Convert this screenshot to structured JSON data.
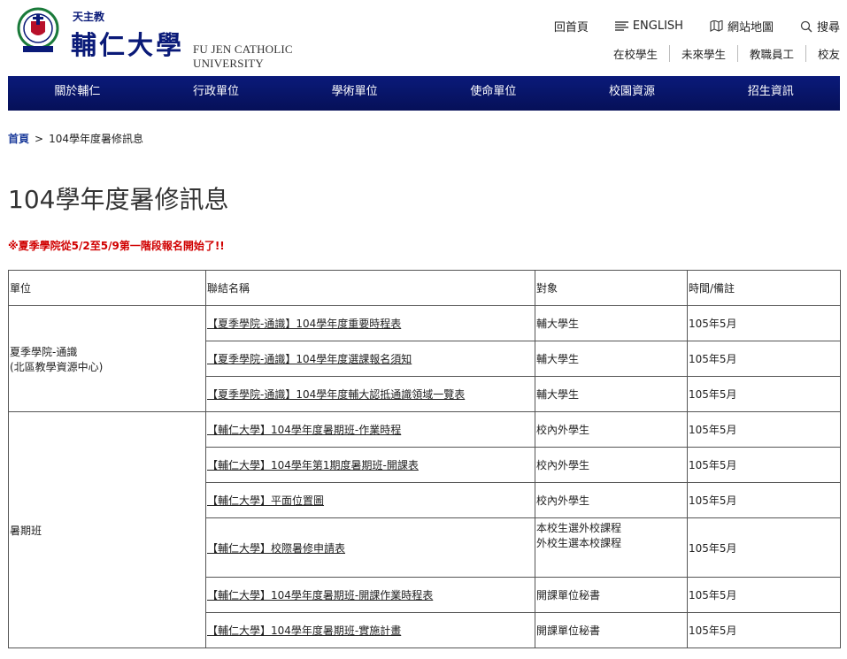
{
  "header": {
    "tagline": "天主教",
    "name_cn": "輔仁大學",
    "name_en": "FU JEN CATHOLIC UNIVERSITY",
    "util": {
      "home": "回首頁",
      "english": "ENGLISH",
      "sitemap": "網站地圖",
      "search": "搜尋"
    },
    "audience": [
      "在校學生",
      "未來學生",
      "教職員工",
      "校友"
    ]
  },
  "nav": [
    "關於輔仁",
    "行政單位",
    "學術單位",
    "使命單位",
    "校園資源",
    "招生資訊"
  ],
  "breadcrumb": {
    "home": "首頁",
    "sep": ">",
    "current": "104學年度暑修訊息"
  },
  "page_title": "104學年度暑修訊息",
  "notice": "※夏季學院從5/2至5/9第一階段報名開始了!!",
  "table": {
    "headers": [
      "單位",
      "聯結名稱",
      "對象",
      "時間/備註"
    ],
    "groups": [
      {
        "unit_line1": "夏季學院-通識",
        "unit_line2": "(北區教學資源中心)",
        "rows": [
          {
            "link": "【夏季學院-通識】104學年度重要時程表",
            "target": "輔大學生",
            "time": "105年5月"
          },
          {
            "link": "【夏季學院-通識】104學年度選課報名須知",
            "target": "輔大學生",
            "time": "105年5月"
          },
          {
            "link": "【夏季學院-通識】104學年度輔大認抵通識領域一覽表",
            "target": "輔大學生",
            "time": "105年5月"
          }
        ]
      },
      {
        "unit_line1": "暑期班",
        "rows": [
          {
            "link": "【輔仁大學】104學年度暑期班-作業時程",
            "target": "校內外學生",
            "time": "105年5月"
          },
          {
            "link": "【輔仁大學】104學年第1期度暑期班-開課表",
            "target": "校內外學生",
            "time": "105年5月"
          },
          {
            "link": "【輔仁大學】平面位置圖",
            "target": "校內外學生",
            "time": "105年5月"
          },
          {
            "link": "【輔仁大學】校際暑修申請表",
            "target_line1": "本校生選外校課程",
            "target_line2": "外校生選本校課程",
            "time": "105年5月"
          },
          {
            "link": "【輔仁大學】104學年度暑期班-開課作業時程表",
            "target": "開課單位秘書",
            "time": "105年5月"
          },
          {
            "link": "【輔仁大學】104學年度暑期班-實施計畫",
            "target": "開課單位秘書",
            "time": "105年5月"
          }
        ]
      }
    ]
  },
  "colors": {
    "nav_bg": "#0a1a7a",
    "brand": "#0a1a78",
    "notice": "#d00000",
    "breadcrumb_link": "#1a3a9a"
  },
  "icons": [
    "seal-logo",
    "menu-lines-icon",
    "map-icon",
    "search-icon"
  ]
}
